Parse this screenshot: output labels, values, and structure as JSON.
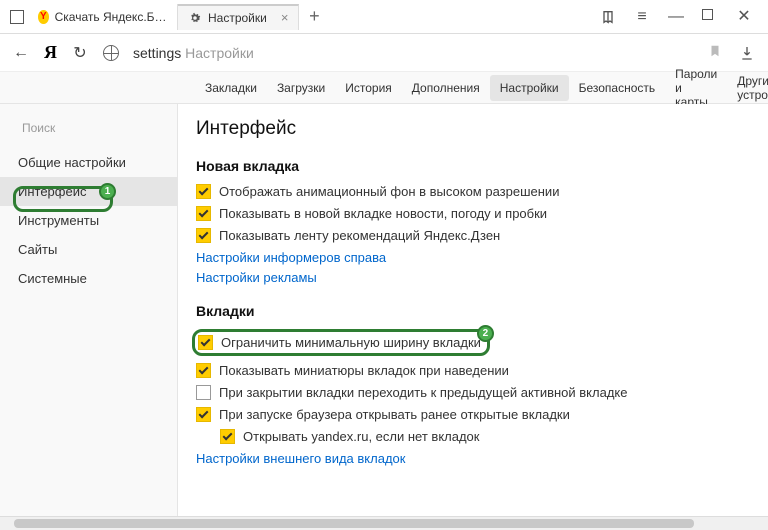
{
  "tabs": {
    "t1": "Скачать Яндекс.Браузер д",
    "t2": "Настройки"
  },
  "address": {
    "host": "settings",
    "page": "Настройки"
  },
  "topnav": {
    "bookmarks": "Закладки",
    "downloads": "Загрузки",
    "history": "История",
    "addons": "Дополнения",
    "settings": "Настройки",
    "security": "Безопасность",
    "passwords": "Пароли и карты",
    "other": "Другие устройс"
  },
  "sidebar": {
    "search_ph": "Поиск",
    "general": "Общие настройки",
    "interface": "Интерфейс",
    "tools": "Инструменты",
    "sites": "Сайты",
    "system": "Системные"
  },
  "badges": {
    "one": "1",
    "two": "2"
  },
  "content": {
    "title": "Интерфейс",
    "newtab": {
      "heading": "Новая вкладка",
      "opt1": "Отображать анимационный фон в высоком разрешении",
      "opt2": "Показывать в новой вкладке новости, погоду и пробки",
      "opt3": "Показывать ленту рекомендаций Яндекс.Дзен",
      "link1": "Настройки информеров справа",
      "link2": "Настройки рекламы"
    },
    "tabsec": {
      "heading": "Вкладки",
      "opt1": "Ограничить минимальную ширину вкладки",
      "opt2": "Показывать миниатюры вкладок при наведении",
      "opt3": "При закрытии вкладки переходить к предыдущей активной вкладке",
      "opt4": "При запуске браузера открывать ранее открытые вкладки",
      "opt5": "Открывать yandex.ru, если нет вкладок",
      "link1": "Настройки внешнего вида вкладок"
    }
  }
}
